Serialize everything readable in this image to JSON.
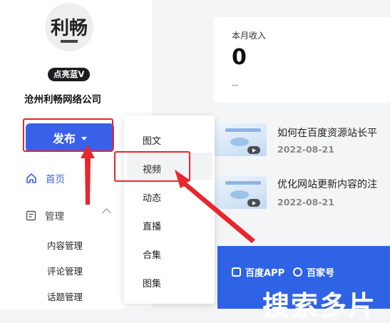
{
  "profile": {
    "avatar_text": "利畅",
    "badge": "点亮蓝V",
    "company": "沧州利畅网络公司"
  },
  "publish": {
    "label": "发布"
  },
  "nav": {
    "home": "首页",
    "manage": "管理",
    "sub_items": [
      "内容管理",
      "评论管理",
      "话题管理"
    ]
  },
  "dropdown": {
    "items": [
      "图文",
      "视频",
      "动态",
      "直播",
      "合集",
      "图集"
    ],
    "highlighted": "视频"
  },
  "income": {
    "label": "本月收入",
    "value": "0",
    "delta": "--"
  },
  "videos": [
    {
      "title": "如何在百度资源站长平",
      "date": "2022-08-21"
    },
    {
      "title": "优化网站更新内容的注",
      "date": "2022-08-21"
    }
  ],
  "banner": {
    "brand1": "百度APP",
    "brand2": "百家号",
    "headline": "搜索多片"
  },
  "colors": {
    "accent": "#3860e8",
    "annotation": "#e8262d",
    "banner": "#2f63e6"
  }
}
